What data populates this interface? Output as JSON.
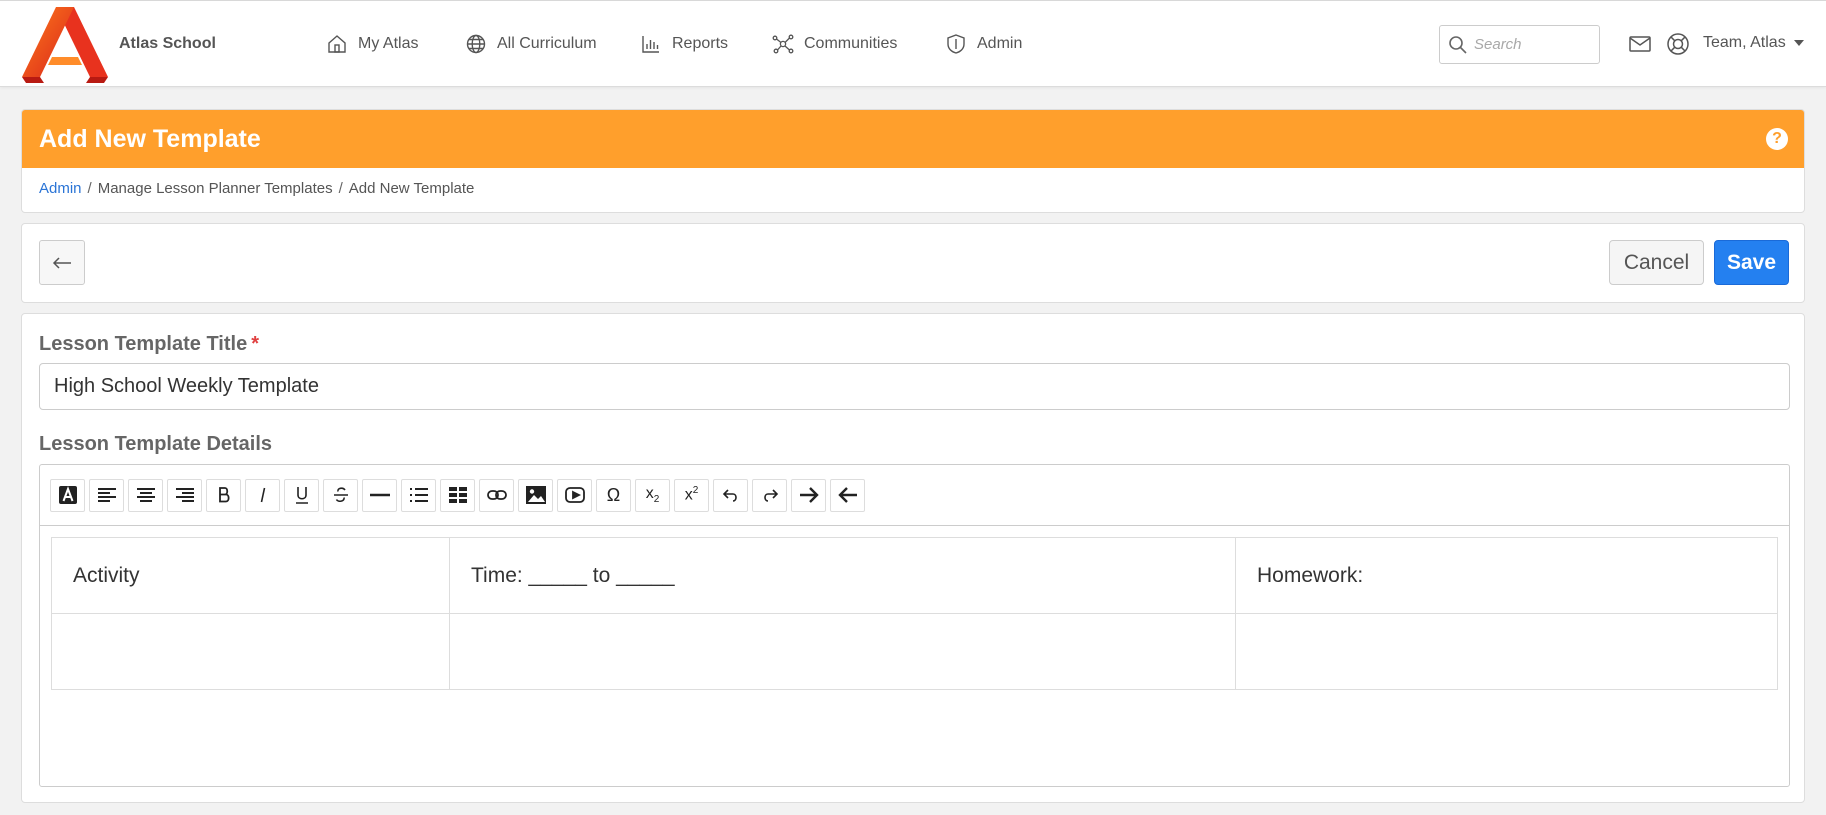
{
  "app": {
    "brand": "Atlas School"
  },
  "nav": {
    "items": [
      {
        "label": "My Atlas",
        "icon": "home-icon"
      },
      {
        "label": "All Curriculum",
        "icon": "globe-icon"
      },
      {
        "label": "Reports",
        "icon": "bar-chart-icon"
      },
      {
        "label": "Communities",
        "icon": "network-icon"
      },
      {
        "label": "Admin",
        "icon": "shield-icon"
      }
    ],
    "search_placeholder": "Search",
    "user_label": "Team, Atlas"
  },
  "header": {
    "title": "Add New Template",
    "breadcrumb": [
      "Admin",
      "Manage Lesson Planner Templates",
      "Add New Template"
    ]
  },
  "actions": {
    "cancel_label": "Cancel",
    "save_label": "Save"
  },
  "form": {
    "title_label": "Lesson Template Title",
    "required_mark": "*",
    "title_value": "High School Weekly Template",
    "details_label": "Lesson Template Details"
  },
  "editor": {
    "toolbar": [
      "text-color",
      "align-left",
      "align-center",
      "align-right",
      "bold",
      "italic",
      "underline",
      "strikethrough",
      "horizontal-rule",
      "bullet-list",
      "table",
      "link",
      "image",
      "video",
      "special-character",
      "subscript",
      "superscript",
      "undo",
      "redo",
      "indent",
      "outdent"
    ],
    "table": [
      [
        "Activity",
        "Time: _____ to _____",
        "Homework:"
      ],
      [
        "",
        "",
        ""
      ]
    ]
  },
  "colors": {
    "header_orange": "#ff9f2c",
    "primary_blue": "#2480f0",
    "link_blue": "#2a74d6"
  }
}
